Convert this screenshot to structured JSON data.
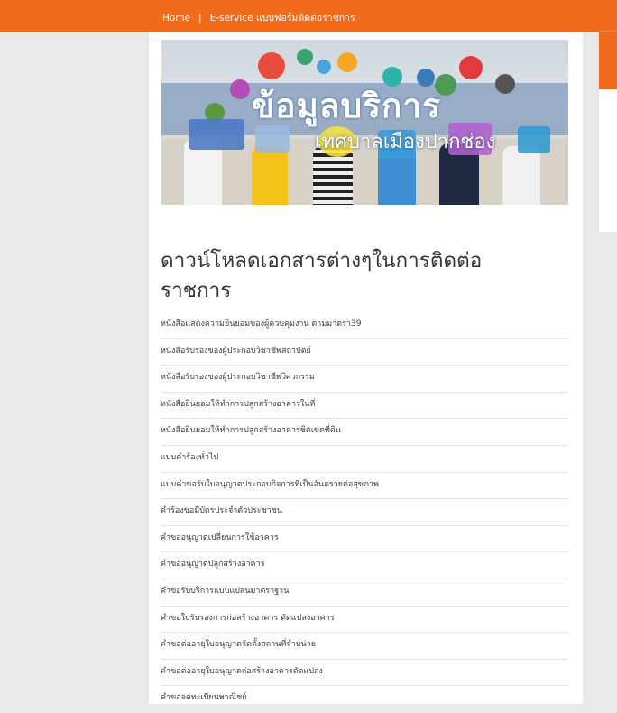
{
  "breadcrumb": {
    "home": "Home",
    "separator": "|",
    "current": "E-service แบบฟอร์มติดต่อราชการ"
  },
  "banner": {
    "title": "ข้อมูลบริการ",
    "subtitle": "เทศบาลเมืองปากช่อง"
  },
  "page_title": "ดาวน์โหลดเอกสารต่างๆในการติดต่อราชการ",
  "documents": [
    "หนังสือแสดงความยินยอมของผู้ควบคุมงาน ตามมาตรา39",
    "หนังสือรับรองของผู้ประกอบวิชาชีพสถาปัตย์",
    "หนังสือรับรองของผู้ประกอบวิชาชีพวิศวกรรม",
    "หนังสือยินยอมให้ทำการปลูกสร้างอาคารในที่",
    "หนังสือยินยอมให้ทำการปลูกสร้างอาคารชิดเขตที่ดิน",
    "แบบคำร้องทั่วไป",
    "แบบคำขอรับใบอนุญาตประกอบกิจการที่เป็นอันตรายต่อสุขภาพ",
    "คำร้องขอมีบัตรประจำตัวประชาชน",
    "คำขออนุญาตเปลี่ยนการใช้อาคาร",
    "คำขออนุญาตปลูกสร้างอาคาร",
    "คำขอรับบริการแบบแปลนมาตราฐาน",
    "คำขอใบรับรองการก่อสร้างอาคาร ดัดแปลงอาคาร",
    "คำขอต่ออายุใบอนุญาตจัดตั้งสถานที่จำหน่าย",
    "คำขอต่ออายุใบอนุญาตก่อสร้างอาคารดัดแปลง",
    "คำขอจดทะเบียนพาณิชย์"
  ],
  "colors": {
    "accent": "#f26b1d",
    "background": "#e9e9e9",
    "content": "#ffffff"
  }
}
